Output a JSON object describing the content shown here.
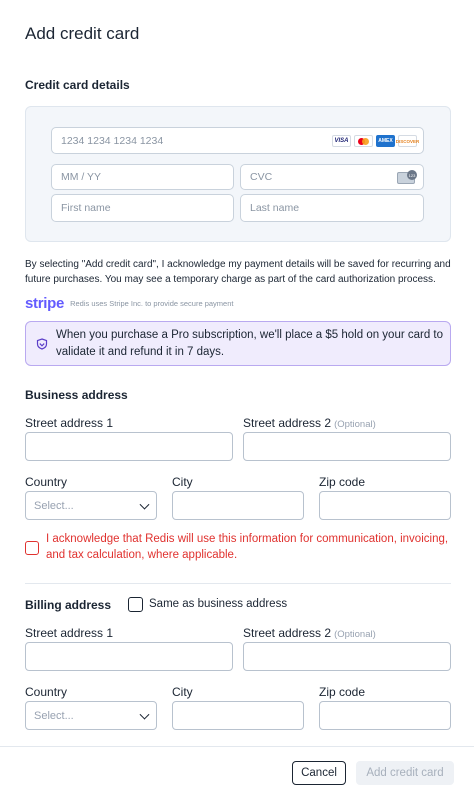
{
  "dialog": {
    "title": "Add credit card"
  },
  "card_section": {
    "heading": "Credit card details",
    "card_number_placeholder": "1234 1234 1234 1234",
    "expiry_placeholder": "MM / YY",
    "cvc_placeholder": "CVC",
    "first_name_placeholder": "First name",
    "last_name_placeholder": "Last name",
    "brands": [
      "VISA",
      "mastercard",
      "AMEX",
      "DISCOVER"
    ]
  },
  "consent_text": "By selecting \"Add credit card\", I acknowledge my payment details will be saved for recurring and future purchases. You may see a temporary charge as part of the card authorization process.",
  "stripe": {
    "logo": "stripe",
    "note": "Redis uses Stripe Inc. to provide secure payment"
  },
  "hold_notice": {
    "text": "When you purchase a Pro subscription, we'll place a $5 hold on your card to validate it and refund it in 7 days.",
    "accent": "#5b3ec8"
  },
  "business": {
    "heading": "Business address",
    "street1_label": "Street address 1",
    "street2_label": "Street address 2",
    "optional": "(Optional)",
    "country_label": "Country",
    "country_placeholder": "Select...",
    "city_label": "City",
    "zip_label": "Zip code"
  },
  "acknowledgement": {
    "text": "I acknowledge that Redis will use this information for communication, invoicing, and tax calculation, where applicable.",
    "checked": false,
    "color": "#e0322f"
  },
  "billing": {
    "heading": "Billing address",
    "same_as_label": "Same as business address",
    "same_as_checked": false,
    "street1_label": "Street address 1",
    "street2_label": "Street address 2",
    "optional": "(Optional)",
    "country_label": "Country",
    "country_placeholder": "Select...",
    "city_label": "City",
    "zip_label": "Zip code"
  },
  "footer": {
    "cancel_label": "Cancel",
    "submit_label": "Add credit card",
    "submit_disabled": true
  }
}
